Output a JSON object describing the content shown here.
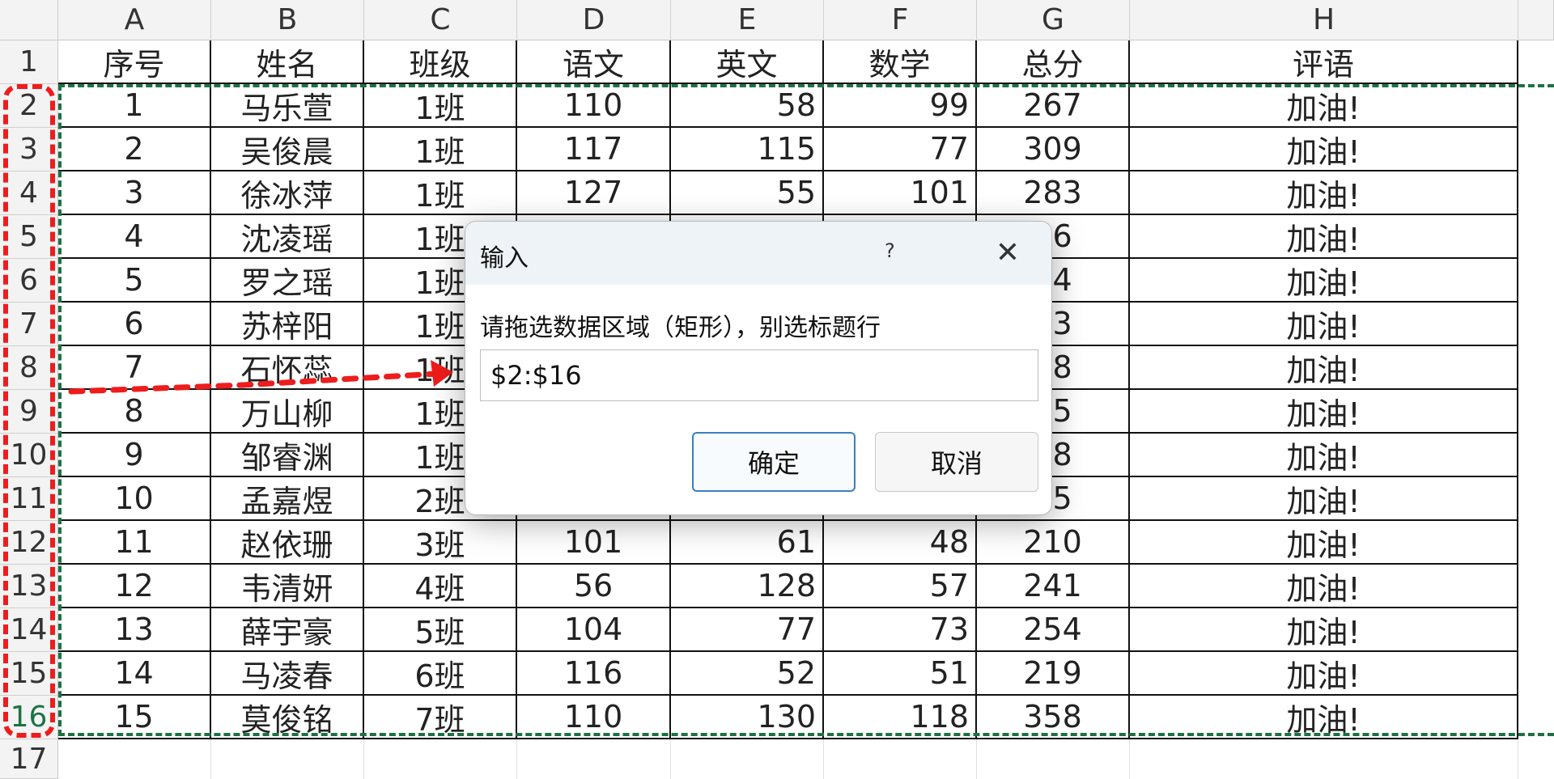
{
  "columns": [
    "A",
    "B",
    "C",
    "D",
    "E",
    "F",
    "G",
    "H"
  ],
  "rows": [
    "1",
    "2",
    "3",
    "4",
    "5",
    "6",
    "7",
    "8",
    "9",
    "10",
    "11",
    "12",
    "13",
    "14",
    "15",
    "16",
    "17"
  ],
  "header": [
    "序号",
    "姓名",
    "班级",
    "语文",
    "英文",
    "数学",
    "总分",
    "评语"
  ],
  "table": [
    [
      "1",
      "马乐萱",
      "1班",
      "110",
      "58",
      "99",
      "267",
      "加油!"
    ],
    [
      "2",
      "吴俊晨",
      "1班",
      "117",
      "115",
      "77",
      "309",
      "加油!"
    ],
    [
      "3",
      "徐冰萍",
      "1班",
      "127",
      "55",
      "101",
      "283",
      "加油!"
    ],
    [
      "4",
      "沈凌瑶",
      "1班",
      "",
      "",
      "",
      "46",
      "加油!"
    ],
    [
      "5",
      "罗之瑶",
      "1班",
      "",
      "",
      "",
      "64",
      "加油!"
    ],
    [
      "6",
      "苏梓阳",
      "1班",
      "",
      "",
      "",
      "13",
      "加油!"
    ],
    [
      "7",
      "石怀蕊",
      "1班",
      "",
      "",
      "",
      "48",
      "加油!"
    ],
    [
      "8",
      "万山柳",
      "1班",
      "",
      "",
      "",
      "25",
      "加油!"
    ],
    [
      "9",
      "邹睿渊",
      "1班",
      "",
      "",
      "",
      "18",
      "加油!"
    ],
    [
      "10",
      "孟嘉煜",
      "2班",
      "",
      "",
      "",
      "45",
      "加油!"
    ],
    [
      "11",
      "赵依珊",
      "3班",
      "101",
      "61",
      "48",
      "210",
      "加油!"
    ],
    [
      "12",
      "韦清妍",
      "4班",
      "56",
      "128",
      "57",
      "241",
      "加油!"
    ],
    [
      "13",
      "薛宇豪",
      "5班",
      "104",
      "77",
      "73",
      "254",
      "加油!"
    ],
    [
      "14",
      "马凌春",
      "6班",
      "116",
      "52",
      "51",
      "219",
      "加油!"
    ],
    [
      "15",
      "莫俊铭",
      "7班",
      "110",
      "130",
      "118",
      "358",
      "加油!"
    ]
  ],
  "dialog": {
    "title": "输入",
    "help": "?",
    "close": "✕",
    "prompt": "请拖选数据区域（矩形），别选标题行",
    "input_value": "$2:$16",
    "ok_label": "确定",
    "cancel_label": "取消"
  },
  "colors": {
    "selection_green": "#1e7145",
    "annotation_red": "#ee1c1c",
    "ok_border": "#3a7fc1"
  }
}
